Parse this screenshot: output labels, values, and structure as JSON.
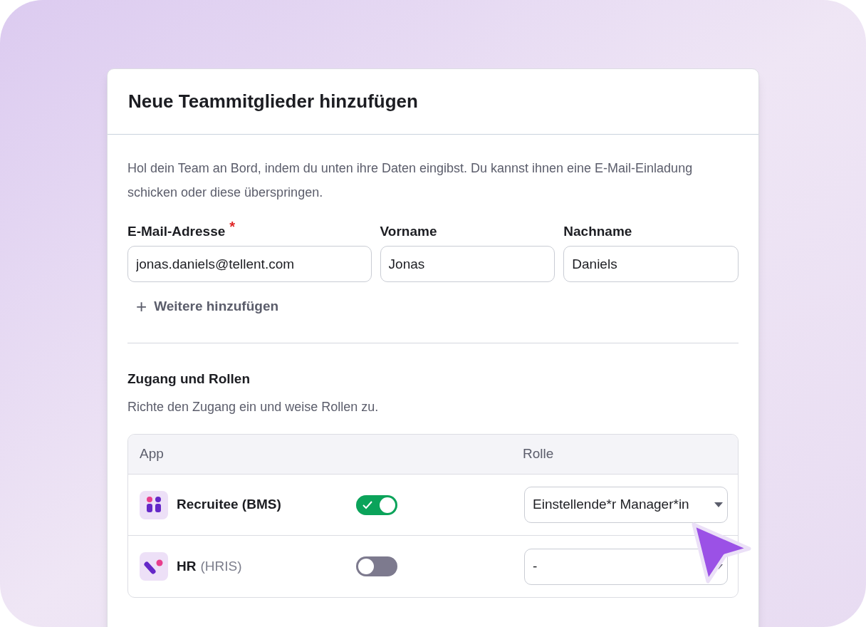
{
  "dialog": {
    "title": "Neue Teammitglieder hinzufügen",
    "intro": "Hol dein Team an Bord, indem du unten ihre Daten eingibst. Du kannst ihnen eine E-Mail-Einladung schicken oder diese überspringen.",
    "fields": [
      {
        "label": "E-Mail-Adresse",
        "required_mark": "*",
        "value": "jonas.daniels@tellent.com"
      },
      {
        "label": "Vorname",
        "value": "Jonas"
      },
      {
        "label": "Nachname",
        "value": "Daniels"
      }
    ],
    "add_more": {
      "icon": "+",
      "label": "Weitere hinzufügen"
    },
    "access": {
      "title": "Zugang und Rollen",
      "subtitle": "Richte den Zugang ein und weise Rollen zu.",
      "columns": [
        "App",
        "Rolle"
      ],
      "rows": [
        {
          "kind": "people",
          "name": "Recruitee (BMS)",
          "enabled": true,
          "role": "Einstellende*r Manager*in"
        },
        {
          "kind": "check",
          "name": "HR",
          "suffix": "(HRIS)",
          "enabled": false,
          "role": "-"
        }
      ]
    }
  }
}
